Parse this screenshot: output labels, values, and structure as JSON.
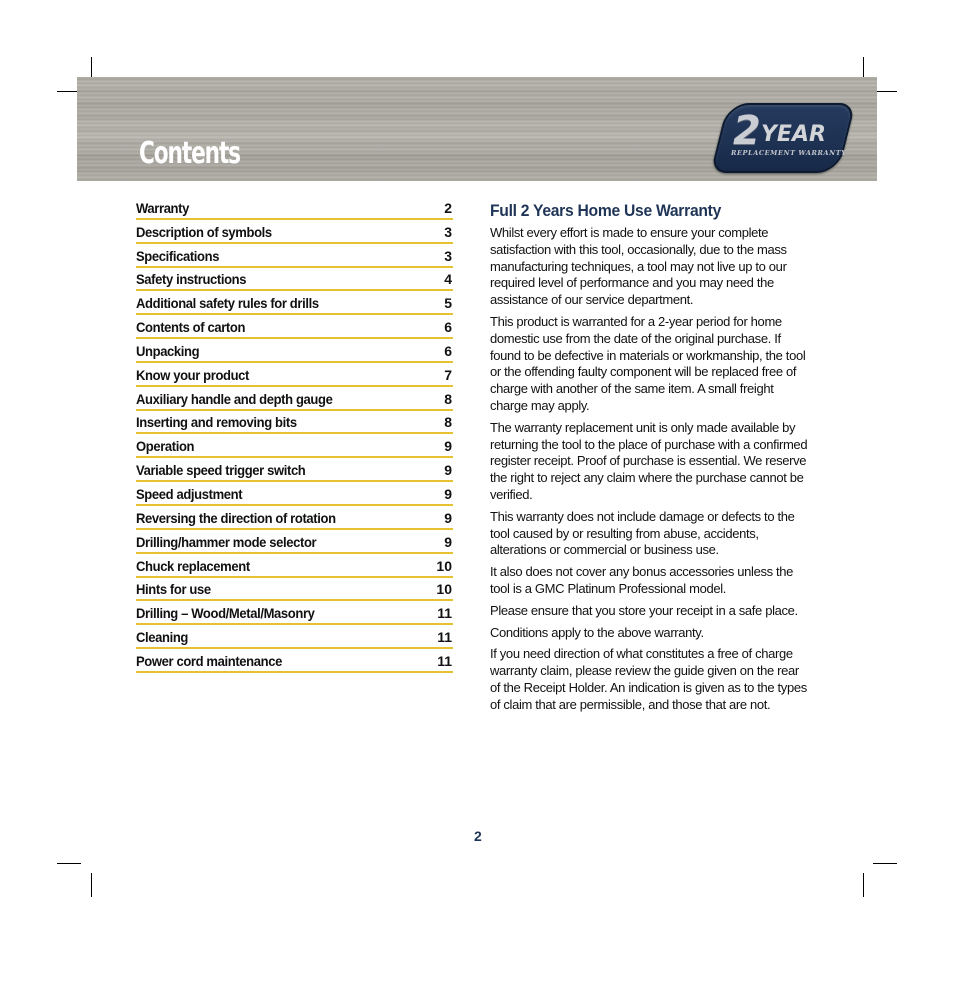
{
  "header": {
    "title": "Contents",
    "badge": {
      "number": "2",
      "word": "YEAR",
      "subtitle": "REPLACEMENT WARRANTY",
      "color": "#1d3152"
    }
  },
  "toc": {
    "underline_color": "#e6c231",
    "items": [
      {
        "label": "Warranty",
        "page": "2"
      },
      {
        "label": "Description of symbols",
        "page": "3"
      },
      {
        "label": "Specifications",
        "page": "3"
      },
      {
        "label": "Safety instructions",
        "page": "4"
      },
      {
        "label": "Additional safety rules for drills",
        "page": "5"
      },
      {
        "label": "Contents of carton",
        "page": "6"
      },
      {
        "label": "Unpacking",
        "page": "6"
      },
      {
        "label": "Know your product",
        "page": "7"
      },
      {
        "label": "Auxiliary handle and depth gauge",
        "page": "8"
      },
      {
        "label": "Inserting and removing bits",
        "page": "8"
      },
      {
        "label": "Operation",
        "page": "9"
      },
      {
        "label": "Variable speed trigger switch",
        "page": "9"
      },
      {
        "label": "Speed adjustment",
        "page": "9"
      },
      {
        "label": "Reversing the direction of rotation",
        "page": "9"
      },
      {
        "label": "Drilling/hammer mode selector",
        "page": "9"
      },
      {
        "label": "Chuck replacement",
        "page": "10"
      },
      {
        "label": "Hints for use",
        "page": "10"
      },
      {
        "label": "Drilling – Wood/Metal/Masonry",
        "page": "11"
      },
      {
        "label": "Cleaning",
        "page": "11"
      },
      {
        "label": "Power cord maintenance",
        "page": "11"
      }
    ]
  },
  "warranty": {
    "heading": "Full 2 Years Home Use Warranty",
    "heading_color": "#1f3557",
    "paragraphs": [
      "Whilst every effort is made to ensure your complete satisfaction with this tool, occasionally, due to the mass manufacturing techniques, a tool may not live up to our required level of performance and you may need the assistance of our service department.",
      "This product is warranted for a 2-year period for home domestic use from the date of the original purchase. If found to be defective in materials or workmanship, the tool or the offending faulty component will be replaced free of charge with another of the same item. A small freight charge may apply.",
      "The warranty replacement unit is only made available by returning the tool to the place of purchase with a confirmed register receipt. Proof of purchase is essential. We reserve the right to reject any claim where the purchase cannot be verified.",
      "This warranty does not include damage or defects to the tool caused by or resulting from abuse, accidents, alterations or commercial or business use.",
      "It also does not cover any bonus accessories unless the tool is a GMC Platinum Professional model.",
      "Please ensure that you store your receipt in a safe place.",
      "Conditions apply to the above warranty.",
      "If you need direction of what constitutes a free of charge warranty claim, please review the guide given on the rear of the Receipt Holder. An indication is given as to the types of claim that are permissible, and those that are not."
    ]
  },
  "footer": {
    "page_number": "2"
  }
}
